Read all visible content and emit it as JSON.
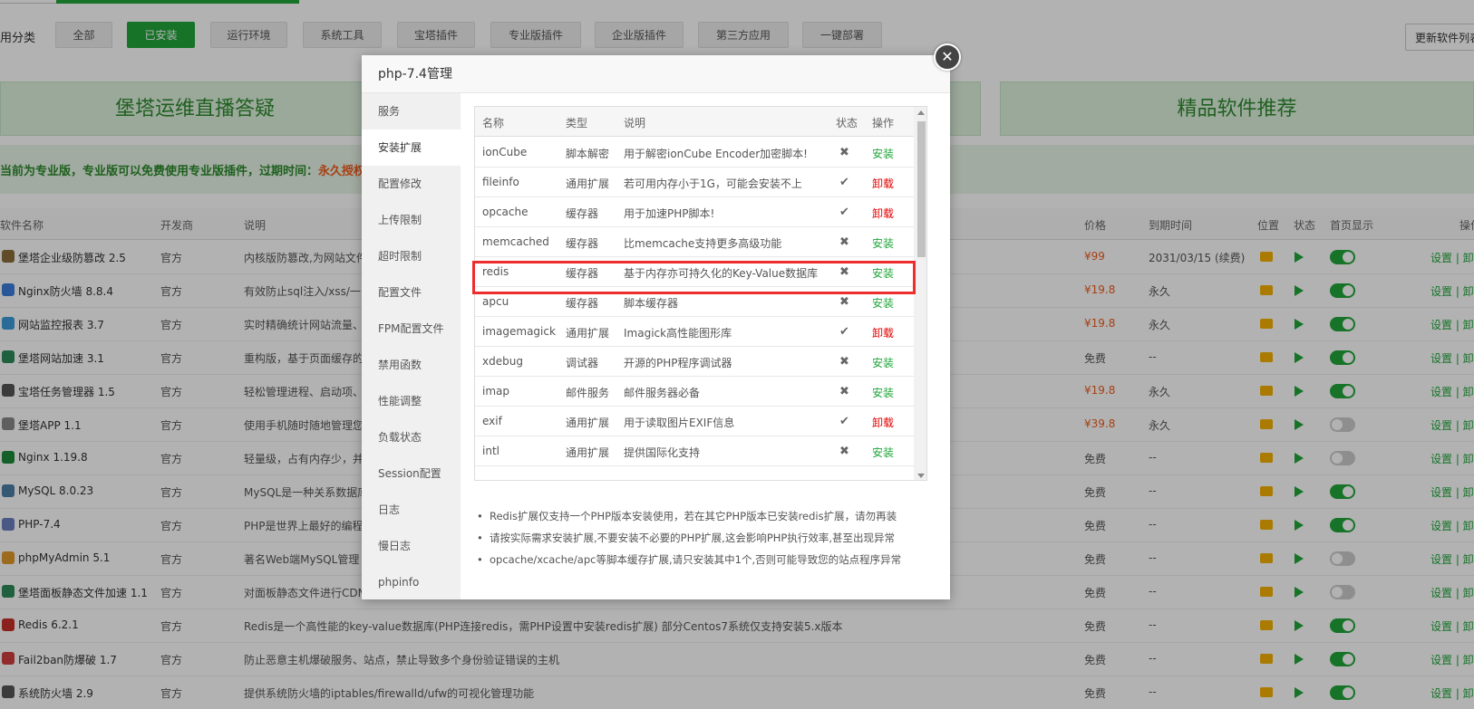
{
  "categories": {
    "label": "用分类",
    "items": [
      {
        "label": "全部",
        "active": false
      },
      {
        "label": "已安装",
        "active": true
      },
      {
        "label": "运行环境",
        "active": false
      },
      {
        "label": "系统工具",
        "active": false
      },
      {
        "label": "宝塔插件",
        "active": false
      },
      {
        "label": "专业版插件",
        "active": false
      },
      {
        "label": "企业版插件",
        "active": false
      },
      {
        "label": "第三方应用",
        "active": false
      },
      {
        "label": "一键部署",
        "active": false
      }
    ],
    "update_button": "更新软件列表"
  },
  "banners": {
    "left": "堡塔运维直播答疑",
    "right": "精品软件推荐"
  },
  "pro_notice": {
    "text": "当前为专业版，专业版可以免费使用专业版插件，过期时间：",
    "highlight": "永久授权"
  },
  "plugin_table": {
    "headers": {
      "name": "软件名称",
      "dev": "开发商",
      "desc": "说明",
      "price": "价格",
      "expire": "到期时间",
      "pos": "位置",
      "state": "状态",
      "home": "首页显示",
      "ops": "操作"
    },
    "rows": [
      {
        "name": "堡塔企业级防篡改 2.5",
        "dev": "官方",
        "desc": "内核版防篡改,为网站文件",
        "price": "¥99",
        "expire": "2031/03/15 (续费)",
        "toggle": true,
        "ops": "设置 | 卸载",
        "icon_color": "#8a6d3b"
      },
      {
        "name": "Nginx防火墙 8.8.4",
        "dev": "官方",
        "desc": "有效防止sql注入/xss/一",
        "price": "¥19.8",
        "expire": "永久",
        "toggle": true,
        "ops": "设置 | 卸载",
        "icon_color": "#3b7dd8"
      },
      {
        "name": "网站监控报表 3.7",
        "dev": "官方",
        "desc": "实时精确统计网站流量、",
        "price": "¥19.8",
        "expire": "永久",
        "toggle": true,
        "ops": "设置 | 卸载",
        "icon_color": "#3b9bd8"
      },
      {
        "name": "堡塔网站加速 3.1",
        "dev": "官方",
        "desc": "重构版，基于页面缓存的",
        "price": "免费",
        "expire": "--",
        "toggle": true,
        "ops": "设置 | 卸载",
        "icon_color": "#2d8a5a"
      },
      {
        "name": "宝塔任务管理器 1.5",
        "dev": "官方",
        "desc": "轻松管理进程、启动项、",
        "price": "¥19.8",
        "expire": "永久",
        "toggle": true,
        "ops": "设置 | 卸载",
        "icon_color": "#555555"
      },
      {
        "name": "堡塔APP 1.1",
        "dev": "官方",
        "desc": "使用手机随时随地管理您",
        "price": "¥39.8",
        "expire": "永久",
        "toggle": false,
        "ops": "设置 | 卸载",
        "icon_color": "#888888"
      },
      {
        "name": "Nginx 1.19.8",
        "dev": "官方",
        "desc": "轻量级，占有内存少，并",
        "price": "免费",
        "expire": "--",
        "toggle": false,
        "ops": "设置 | 卸载",
        "icon_color": "#1e8a3c"
      },
      {
        "name": "MySQL 8.0.23",
        "dev": "官方",
        "desc": "MySQL是一种关系数据库",
        "price": "免费",
        "expire": "--",
        "toggle": true,
        "ops": "设置 | 卸载",
        "icon_color": "#4d7fa8"
      },
      {
        "name": "PHP-7.4",
        "dev": "官方",
        "desc": "PHP是世界上最好的编程",
        "price": "免费",
        "expire": "--",
        "toggle": true,
        "ops": "设置 | 卸载",
        "icon_color": "#6b7fc0"
      },
      {
        "name": "phpMyAdmin 5.1",
        "dev": "官方",
        "desc": "著名Web端MySQL管理",
        "price": "免费",
        "expire": "--",
        "toggle": false,
        "ops": "设置 | 卸载",
        "icon_color": "#e09a2a"
      },
      {
        "name": "堡塔面板静态文件加速 1.1",
        "dev": "官方",
        "desc": "对面板静态文件进行CDN加速，加快面板加载速度，提升对小带宽和海外服务器的面板使用体验!",
        "price": "免费",
        "expire": "--",
        "toggle": false,
        "ops": "设置 | 卸载",
        "icon_color": "#2d8a5a"
      },
      {
        "name": "Redis 6.2.1",
        "dev": "官方",
        "desc": "Redis是一个高性能的key-value数据库(PHP连接redis，需PHP设置中安装redis扩展) 部分Centos7系统仅支持安装5.x版本",
        "price": "免费",
        "expire": "--",
        "toggle": true,
        "ops": "设置 | 卸载",
        "icon_color": "#c8302a"
      },
      {
        "name": "Fail2ban防爆破 1.7",
        "dev": "官方",
        "desc": "防止恶意主机爆破服务、站点，禁止导致多个身份验证错误的主机",
        "price": "免费",
        "expire": "--",
        "toggle": true,
        "ops": "设置 | 卸载",
        "icon_color": "#d04040"
      },
      {
        "name": "系统防火墙 2.9",
        "dev": "官方",
        "desc": "提供系统防火墙的iptables/firewalld/ufw的可视化管理功能",
        "price": "免费",
        "expire": "--",
        "toggle": true,
        "ops": "设置 | 卸载",
        "icon_color": "#555555"
      }
    ]
  },
  "modal": {
    "title": "php-7.4管理",
    "close_icon": "✕",
    "menu": [
      {
        "label": "服务",
        "active": false
      },
      {
        "label": "安装扩展",
        "active": true
      },
      {
        "label": "配置修改",
        "active": false
      },
      {
        "label": "上传限制",
        "active": false
      },
      {
        "label": "超时限制",
        "active": false
      },
      {
        "label": "配置文件",
        "active": false
      },
      {
        "label": "FPM配置文件",
        "active": false
      },
      {
        "label": "禁用函数",
        "active": false
      },
      {
        "label": "性能调整",
        "active": false
      },
      {
        "label": "负载状态",
        "active": false
      },
      {
        "label": "Session配置",
        "active": false
      },
      {
        "label": "日志",
        "active": false
      },
      {
        "label": "慢日志",
        "active": false
      },
      {
        "label": "phpinfo",
        "active": false
      }
    ],
    "ext_headers": {
      "name": "名称",
      "type": "类型",
      "desc": "说明",
      "status": "状态",
      "action": "操作"
    },
    "extensions": [
      {
        "name": "ionCube",
        "type": "脚本解密",
        "desc": "用于解密ionCube Encoder加密脚本!",
        "installed": false,
        "action": "安装"
      },
      {
        "name": "fileinfo",
        "type": "通用扩展",
        "desc": "若可用内存小于1G，可能会安装不上",
        "installed": true,
        "action": "卸载"
      },
      {
        "name": "opcache",
        "type": "缓存器",
        "desc": "用于加速PHP脚本!",
        "installed": true,
        "action": "卸载"
      },
      {
        "name": "memcached",
        "type": "缓存器",
        "desc": "比memcache支持更多高级功能",
        "installed": false,
        "action": "安装"
      },
      {
        "name": "redis",
        "type": "缓存器",
        "desc": "基于内存亦可持久化的Key-Value数据库",
        "installed": false,
        "action": "安装"
      },
      {
        "name": "apcu",
        "type": "缓存器",
        "desc": "脚本缓存器",
        "installed": false,
        "action": "安装"
      },
      {
        "name": "imagemagick",
        "type": "通用扩展",
        "desc": "Imagick高性能图形库",
        "installed": true,
        "action": "卸载"
      },
      {
        "name": "xdebug",
        "type": "调试器",
        "desc": "开源的PHP程序调试器",
        "installed": false,
        "action": "安装"
      },
      {
        "name": "imap",
        "type": "邮件服务",
        "desc": "邮件服务器必备",
        "installed": false,
        "action": "安装"
      },
      {
        "name": "exif",
        "type": "通用扩展",
        "desc": "用于读取图片EXIF信息",
        "installed": true,
        "action": "卸载"
      },
      {
        "name": "intl",
        "type": "通用扩展",
        "desc": "提供国际化支持",
        "installed": false,
        "action": "安装"
      }
    ],
    "status_symbols": {
      "installed": "✔",
      "not_installed": "✖"
    },
    "notes": [
      "Redis扩展仅支持一个PHP版本安装使用，若在其它PHP版本已安装redis扩展，请勿再装",
      "请按实际需求安装扩展,不要安装不必要的PHP扩展,这会影响PHP执行效率,甚至出现异常",
      "opcache/xcache/apc等脚本缓存扩展,请只安装其中1个,否则可能导致您的站点程序异常"
    ]
  }
}
